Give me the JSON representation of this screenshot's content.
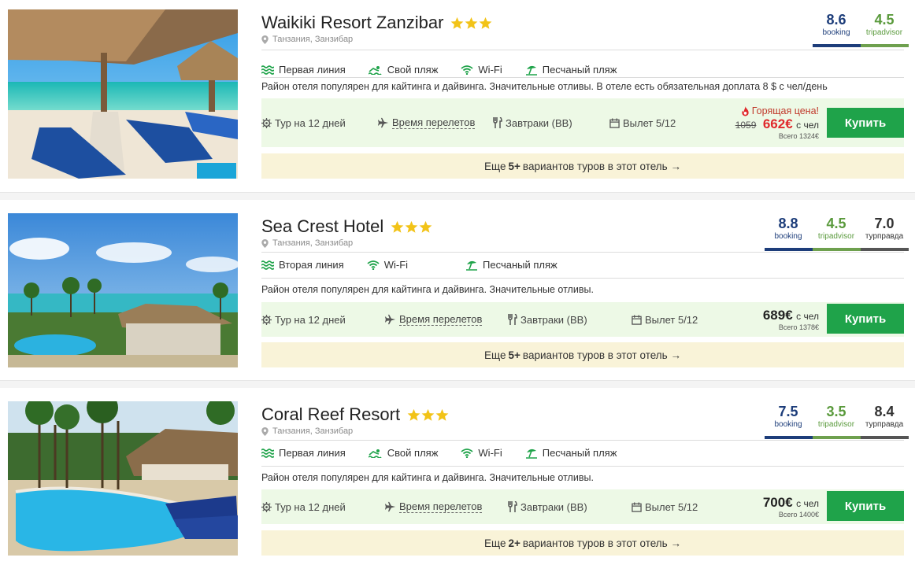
{
  "colors": {
    "accent_green": "#1fa34a",
    "booking": "#1d3d7a",
    "tripadvisor": "#5a9a3c",
    "hot": "#e0282b",
    "offer_bg": "#edf9e6",
    "more_bg": "#f9f3d8"
  },
  "hotels": [
    {
      "name": "Waikiki Resort Zanzibar",
      "stars": 3,
      "location": "Танзания, Занзибар",
      "ratings": [
        {
          "value": "8.6",
          "source": "booking"
        },
        {
          "value": "4.5",
          "source": "tripadvisor"
        }
      ],
      "features": [
        "Первая линия",
        "Свой пляж",
        "Wi-Fi",
        "Песчаный пляж"
      ],
      "description": "Район отеля популярен для кайтинга и дайвинга. Значительные отливы. В отеле есть обязательная доплата 8 $ с чел/день",
      "tour": "Тур на 12 дней",
      "flight": "Время перелетов",
      "meals": "Завтраки (BB)",
      "departure": "Вылет 5/12",
      "hot_label": "Горящая цена!",
      "old_price": "1059",
      "price": "662€",
      "per_person": "с чел",
      "total": "Всего 1324€",
      "buy": "Купить",
      "more_prefix": "Еще",
      "more_count": "5+",
      "more_suffix": "вариантов туров в этот отель →"
    },
    {
      "name": "Sea Crest Hotel",
      "stars": 3,
      "location": "Танзания, Занзибар",
      "ratings": [
        {
          "value": "8.8",
          "source": "booking"
        },
        {
          "value": "4.5",
          "source": "tripadvisor"
        },
        {
          "value": "7.0",
          "source": "турправда"
        }
      ],
      "features": [
        "Вторая линия",
        "Wi-Fi",
        "Песчаный пляж"
      ],
      "description": "Район отеля популярен для кайтинга и дайвинга. Значительные отливы.",
      "tour": "Тур на 12 дней",
      "flight": "Время перелетов",
      "meals": "Завтраки (BB)",
      "departure": "Вылет 5/12",
      "price": "689€",
      "per_person": "с чел",
      "total": "Всего 1378€",
      "buy": "Купить",
      "more_prefix": "Еще",
      "more_count": "5+",
      "more_suffix": "вариантов туров в этот отель →"
    },
    {
      "name": "Coral Reef Resort",
      "stars": 3,
      "location": "Танзания, Занзибар",
      "ratings": [
        {
          "value": "7.5",
          "source": "booking"
        },
        {
          "value": "3.5",
          "source": "tripadvisor"
        },
        {
          "value": "8.4",
          "source": "турправда"
        }
      ],
      "features": [
        "Первая линия",
        "Свой пляж",
        "Wi-Fi",
        "Песчаный пляж"
      ],
      "description": "Район отеля популярен для кайтинга и дайвинга. Значительные отливы.",
      "tour": "Тур на 12 дней",
      "flight": "Время перелетов",
      "meals": "Завтраки (BB)",
      "departure": "Вылет 5/12",
      "price": "700€",
      "per_person": "с чел",
      "total": "Всего 1400€",
      "buy": "Купить",
      "more_prefix": "Еще",
      "more_count": "2+",
      "more_suffix": "вариантов туров в этот отель →"
    }
  ]
}
